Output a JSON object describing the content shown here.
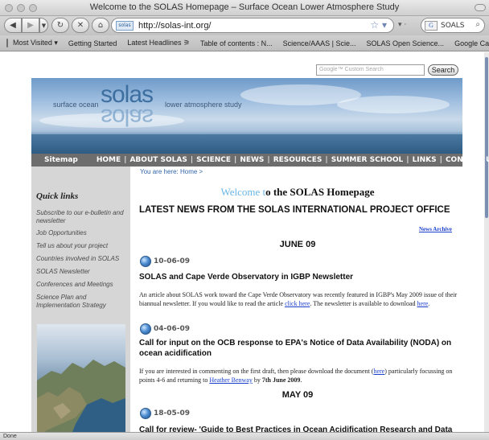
{
  "window": {
    "title": "Welcome to the SOLAS Homepage – Surface Ocean Lower Atmosphere Study"
  },
  "toolbar": {
    "favicon_label": "solas",
    "url": "http://solas-int.org/",
    "search_engine_glyph": "G",
    "search_value": "SOALS"
  },
  "bookmarks": [
    "Most Visited ▾",
    "Getting Started",
    "Latest Headlines ⚞",
    "Table of contents : N...",
    "Science/AAAS | Scie...",
    "SOLAS Open Science...",
    "Google Calendar"
  ],
  "site_search": {
    "placeholder": "Google™ Custom Search",
    "button": "Search"
  },
  "banner": {
    "left_text": "surface ocean",
    "logo": "solas",
    "right_text": "lower atmosphere study"
  },
  "nav": {
    "sitemap": "Sitemap",
    "links": [
      "HOME",
      "ABOUT SOLAS",
      "SCIENCE",
      "NEWS",
      "RESOURCES",
      "SUMMER SCHOOL",
      "LINKS",
      "CONTACT US"
    ]
  },
  "sidebar": {
    "title": "Quick links",
    "items": [
      "Subscribe to our e-bulletin and newsletter",
      "Job Opportunities",
      "Tell us about your project",
      "Countries involved in SOLAS",
      "SOLAS Newsletter",
      "Conferences and Meetings",
      "Science Plan and Implementation Strategy"
    ]
  },
  "main": {
    "breadcrumb": "You are here: Home >",
    "welcome_hl": "Welcome t",
    "welcome_rest": "o the SOLAS Homepage",
    "latest_title": "LATEST NEWS FROM THE SOLAS INTERNATIONAL PROJECT OFFICE",
    "archive_link": "News Archive",
    "month1": "JUNE 09",
    "month2": "MAY 09",
    "news": [
      {
        "date": "10-06-09",
        "headline": "SOLAS and Cape Verde Observatory in IGBP Newsletter",
        "text_a": "An article about SOLAS work toward the Cape Verde Observatory was recently featured in IGBP's May 2009 issue of their biannual newsletter. If you would like to read the article ",
        "link_a": "click here",
        "text_b": ". The newsletter is available to download ",
        "link_b": "here",
        "text_c": "."
      },
      {
        "date": "04-06-09",
        "headline": "Call for input on the OCB response to EPA's Notice of Data Availability (NODA) on ocean acidification",
        "text_a": "If you are interested in commenting on the first draft, then please download the document (",
        "link_a": "here",
        "text_b": ") particularly focussing on points 4-6 and returning to ",
        "link_b": "Heather Benway",
        "text_c": " by ",
        "bold_c": "7th June 2009",
        "text_d": "."
      },
      {
        "date": "18-05-09",
        "headline": "Call for review- 'Guide to Best Practices in Ocean Acidification Research and Data"
      }
    ]
  },
  "status": {
    "text": "Done"
  }
}
